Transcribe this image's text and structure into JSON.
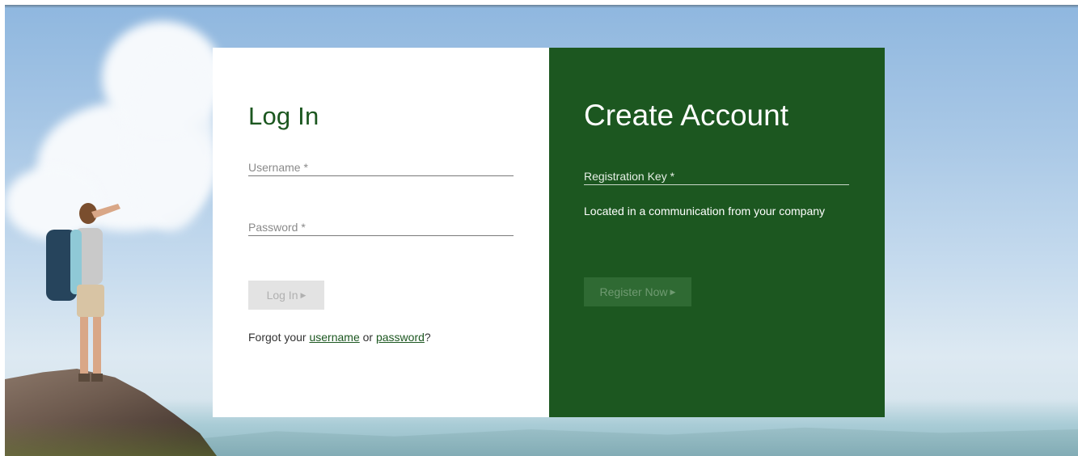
{
  "login": {
    "title": "Log In",
    "username_placeholder": "Username *",
    "password_placeholder": "Password *",
    "button_label": "Log In",
    "forgot_prefix": "Forgot your ",
    "forgot_username_link": "username",
    "forgot_or": " or ",
    "forgot_password_link": "password",
    "forgot_suffix": "?"
  },
  "register": {
    "title": "Create Account",
    "key_placeholder": "Registration Key *",
    "hint": "Located in a communication from your company",
    "button_label": "Register Now"
  },
  "icons": {
    "button_caret": "caret-right-icon"
  },
  "colors": {
    "brand_green": "#1c5720",
    "panel_white": "#ffffff",
    "disabled_button_bg": "#e3e3e3",
    "disabled_register_bg": "#2f6a33"
  }
}
